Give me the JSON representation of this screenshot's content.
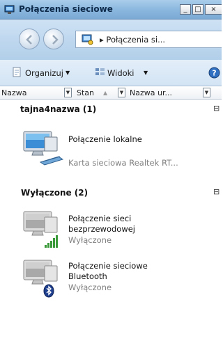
{
  "window": {
    "title": "Połączenia sieciowe",
    "controls": {
      "minimize": "_",
      "maximize": "□",
      "close": "×"
    }
  },
  "address": {
    "path": "▸ Połączenia si..."
  },
  "toolbar": {
    "organize": "Organizuj",
    "views": "Widoki",
    "dropdown_arrow": "▼"
  },
  "columns": {
    "name": "Nazwa",
    "status": "Stan",
    "device": "Nazwa ur..."
  },
  "groups": [
    {
      "header": "tajna4nazwa (1)",
      "items": [
        {
          "name": "Połączenie lokalne",
          "detail": "Karta sieciowa Realtek RT..."
        }
      ]
    },
    {
      "header": "Wyłączone (2)",
      "items": [
        {
          "name_line1": "Połączenie sieci",
          "name_line2": "bezprzewodowej",
          "detail": "Wyłączone"
        },
        {
          "name_line1": "Połączenie sieciowe",
          "name_line2": "Bluetooth",
          "detail": "Wyłączone"
        }
      ]
    }
  ],
  "colors": {
    "accent": "#7aa9d4",
    "muted_text": "#808080"
  }
}
